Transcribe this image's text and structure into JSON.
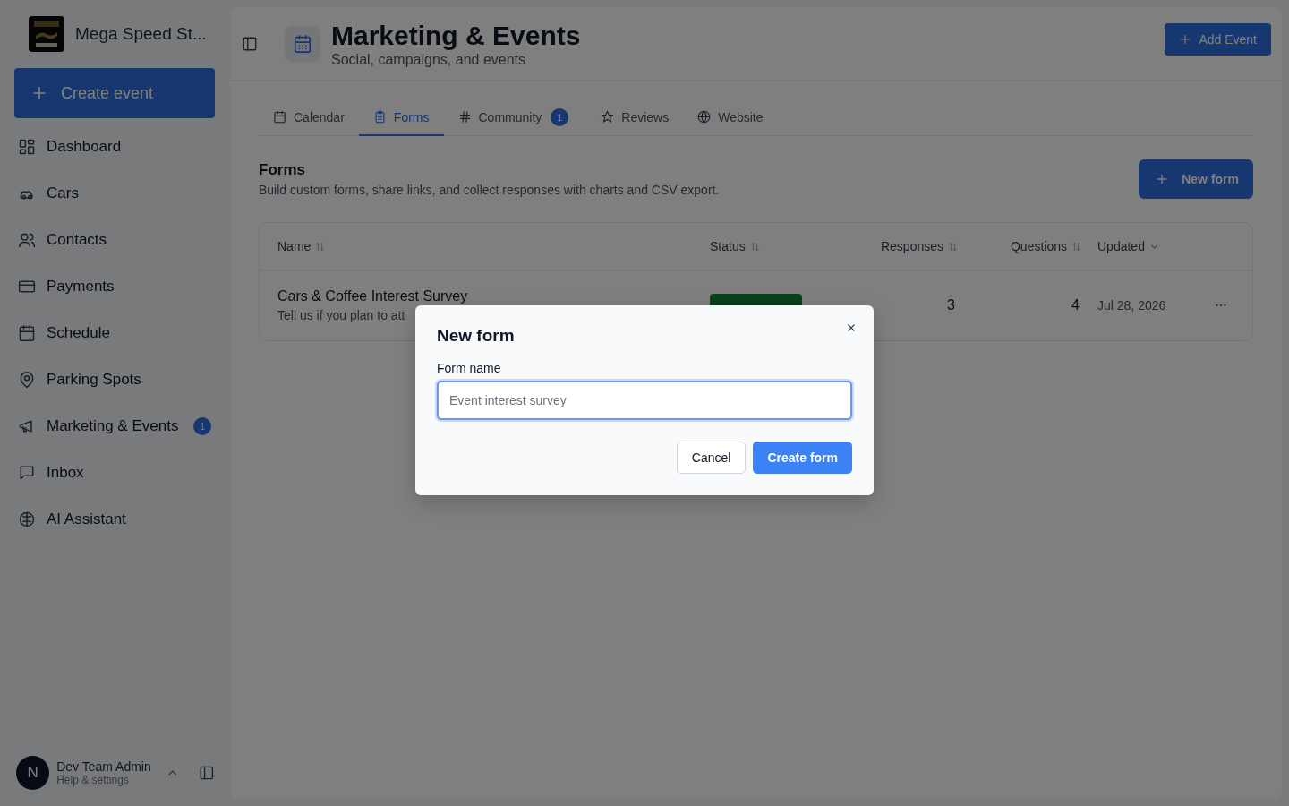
{
  "sidebar": {
    "brand": {
      "name": "Mega Speed St..."
    },
    "create_button": "Create event",
    "items": [
      {
        "label": "Dashboard"
      },
      {
        "label": "Cars"
      },
      {
        "label": "Contacts"
      },
      {
        "label": "Payments"
      },
      {
        "label": "Schedule"
      },
      {
        "label": "Parking Spots"
      },
      {
        "label": "Marketing & Events",
        "badge": "1"
      },
      {
        "label": "Inbox"
      },
      {
        "label": "AI Assistant"
      }
    ],
    "user": {
      "initial": "N",
      "name": "Dev Team Admin",
      "subtitle": "Help & settings"
    }
  },
  "header": {
    "title": "Marketing & Events",
    "subtitle": "Social, campaigns, and events",
    "action": "Add Event"
  },
  "tabs": [
    {
      "label": "Calendar",
      "selected": false
    },
    {
      "label": "Forms",
      "selected": true
    },
    {
      "label": "Community",
      "selected": false,
      "badge": "1"
    },
    {
      "label": "Reviews",
      "selected": false
    },
    {
      "label": "Website",
      "selected": false
    }
  ],
  "section": {
    "title": "Forms",
    "description": "Build custom forms, share links, and collect responses with charts and CSV export.",
    "action": "New form"
  },
  "table": {
    "columns": [
      {
        "label": "Name",
        "sorted": false
      },
      {
        "label": "Status",
        "sorted": false
      },
      {
        "label": "Responses",
        "sorted": false
      },
      {
        "label": "Questions",
        "sorted": false
      },
      {
        "label": "Updated",
        "sorted": true
      }
    ],
    "rows": [
      {
        "name": "Cars & Coffee Interest Survey",
        "description": "Tell us if you plan to att",
        "responses": "3",
        "questions": "4",
        "updated": "Jul 28, 2026"
      }
    ]
  },
  "dialog": {
    "title": "New form",
    "field_label": "Form name",
    "placeholder": "Event interest survey",
    "buttons": [
      {
        "label": "Cancel",
        "kind": "secondary"
      },
      {
        "label": "Create form",
        "kind": "primary"
      }
    ]
  }
}
